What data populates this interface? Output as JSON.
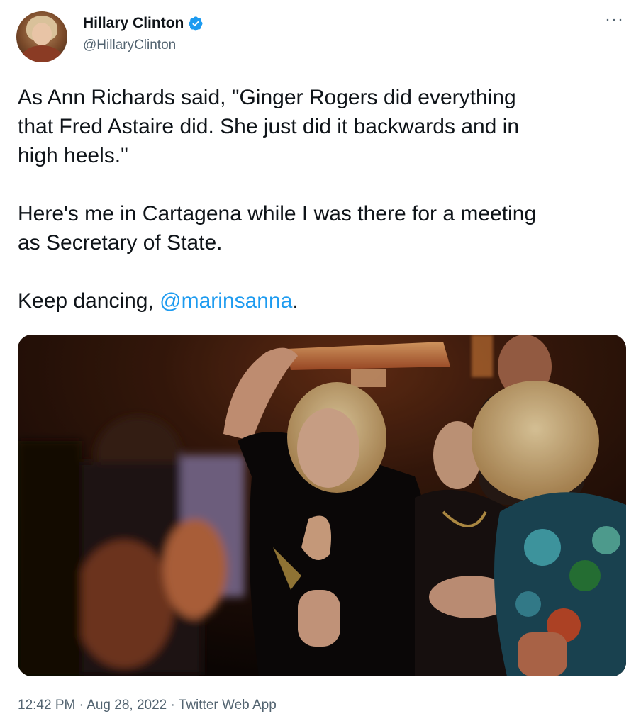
{
  "author": {
    "display_name": "Hillary Clinton",
    "handle": "@HillaryClinton",
    "verified": true,
    "verified_color": "#1d9bf0",
    "avatar_icon": "profile-photo"
  },
  "menu": {
    "more_label": "···"
  },
  "tweet": {
    "line1": "As Ann Richards said, \"Ginger Rogers did everything",
    "line2": "that Fred Astaire did. She just did it backwards and in",
    "line3": "high heels.\"",
    "line4": "Here's me in Cartagena while I was there for a meeting",
    "line5": "as Secretary of State.",
    "line6_prefix": "Keep dancing, ",
    "mention": "@marinsanna",
    "line6_suffix": "."
  },
  "media": {
    "kind": "photo"
  },
  "meta": {
    "time": "12:42 PM",
    "separator": " · ",
    "date": "Aug 28, 2022",
    "source": "Twitter Web App"
  },
  "colors": {
    "text": "#0f1419",
    "secondary": "#536471",
    "link": "#1d9bf0"
  }
}
